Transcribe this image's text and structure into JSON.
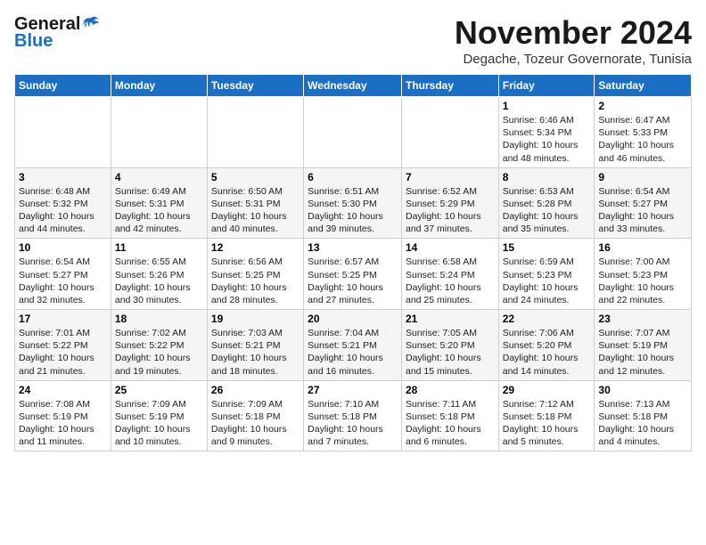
{
  "logo": {
    "general": "General",
    "blue": "Blue"
  },
  "title": "November 2024",
  "subtitle": "Degache, Tozeur Governorate, Tunisia",
  "weekdays": [
    "Sunday",
    "Monday",
    "Tuesday",
    "Wednesday",
    "Thursday",
    "Friday",
    "Saturday"
  ],
  "weeks": [
    [
      null,
      null,
      null,
      null,
      null,
      {
        "day": "1",
        "info": "Sunrise: 6:46 AM\nSunset: 5:34 PM\nDaylight: 10 hours and 48 minutes."
      },
      {
        "day": "2",
        "info": "Sunrise: 6:47 AM\nSunset: 5:33 PM\nDaylight: 10 hours and 46 minutes."
      }
    ],
    [
      {
        "day": "3",
        "info": "Sunrise: 6:48 AM\nSunset: 5:32 PM\nDaylight: 10 hours and 44 minutes."
      },
      {
        "day": "4",
        "info": "Sunrise: 6:49 AM\nSunset: 5:31 PM\nDaylight: 10 hours and 42 minutes."
      },
      {
        "day": "5",
        "info": "Sunrise: 6:50 AM\nSunset: 5:31 PM\nDaylight: 10 hours and 40 minutes."
      },
      {
        "day": "6",
        "info": "Sunrise: 6:51 AM\nSunset: 5:30 PM\nDaylight: 10 hours and 39 minutes."
      },
      {
        "day": "7",
        "info": "Sunrise: 6:52 AM\nSunset: 5:29 PM\nDaylight: 10 hours and 37 minutes."
      },
      {
        "day": "8",
        "info": "Sunrise: 6:53 AM\nSunset: 5:28 PM\nDaylight: 10 hours and 35 minutes."
      },
      {
        "day": "9",
        "info": "Sunrise: 6:54 AM\nSunset: 5:27 PM\nDaylight: 10 hours and 33 minutes."
      }
    ],
    [
      {
        "day": "10",
        "info": "Sunrise: 6:54 AM\nSunset: 5:27 PM\nDaylight: 10 hours and 32 minutes."
      },
      {
        "day": "11",
        "info": "Sunrise: 6:55 AM\nSunset: 5:26 PM\nDaylight: 10 hours and 30 minutes."
      },
      {
        "day": "12",
        "info": "Sunrise: 6:56 AM\nSunset: 5:25 PM\nDaylight: 10 hours and 28 minutes."
      },
      {
        "day": "13",
        "info": "Sunrise: 6:57 AM\nSunset: 5:25 PM\nDaylight: 10 hours and 27 minutes."
      },
      {
        "day": "14",
        "info": "Sunrise: 6:58 AM\nSunset: 5:24 PM\nDaylight: 10 hours and 25 minutes."
      },
      {
        "day": "15",
        "info": "Sunrise: 6:59 AM\nSunset: 5:23 PM\nDaylight: 10 hours and 24 minutes."
      },
      {
        "day": "16",
        "info": "Sunrise: 7:00 AM\nSunset: 5:23 PM\nDaylight: 10 hours and 22 minutes."
      }
    ],
    [
      {
        "day": "17",
        "info": "Sunrise: 7:01 AM\nSunset: 5:22 PM\nDaylight: 10 hours and 21 minutes."
      },
      {
        "day": "18",
        "info": "Sunrise: 7:02 AM\nSunset: 5:22 PM\nDaylight: 10 hours and 19 minutes."
      },
      {
        "day": "19",
        "info": "Sunrise: 7:03 AM\nSunset: 5:21 PM\nDaylight: 10 hours and 18 minutes."
      },
      {
        "day": "20",
        "info": "Sunrise: 7:04 AM\nSunset: 5:21 PM\nDaylight: 10 hours and 16 minutes."
      },
      {
        "day": "21",
        "info": "Sunrise: 7:05 AM\nSunset: 5:20 PM\nDaylight: 10 hours and 15 minutes."
      },
      {
        "day": "22",
        "info": "Sunrise: 7:06 AM\nSunset: 5:20 PM\nDaylight: 10 hours and 14 minutes."
      },
      {
        "day": "23",
        "info": "Sunrise: 7:07 AM\nSunset: 5:19 PM\nDaylight: 10 hours and 12 minutes."
      }
    ],
    [
      {
        "day": "24",
        "info": "Sunrise: 7:08 AM\nSunset: 5:19 PM\nDaylight: 10 hours and 11 minutes."
      },
      {
        "day": "25",
        "info": "Sunrise: 7:09 AM\nSunset: 5:19 PM\nDaylight: 10 hours and 10 minutes."
      },
      {
        "day": "26",
        "info": "Sunrise: 7:09 AM\nSunset: 5:18 PM\nDaylight: 10 hours and 9 minutes."
      },
      {
        "day": "27",
        "info": "Sunrise: 7:10 AM\nSunset: 5:18 PM\nDaylight: 10 hours and 7 minutes."
      },
      {
        "day": "28",
        "info": "Sunrise: 7:11 AM\nSunset: 5:18 PM\nDaylight: 10 hours and 6 minutes."
      },
      {
        "day": "29",
        "info": "Sunrise: 7:12 AM\nSunset: 5:18 PM\nDaylight: 10 hours and 5 minutes."
      },
      {
        "day": "30",
        "info": "Sunrise: 7:13 AM\nSunset: 5:18 PM\nDaylight: 10 hours and 4 minutes."
      }
    ]
  ]
}
